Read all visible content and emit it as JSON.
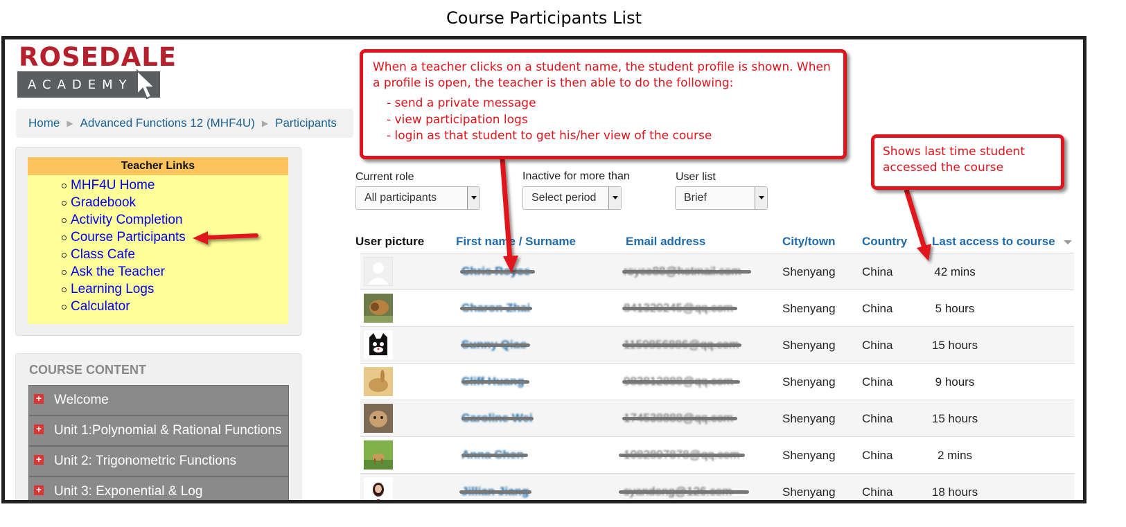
{
  "document_title": "Course Participants List",
  "logo": {
    "top": "ROSEDALE",
    "bottom": "ACADEMY"
  },
  "breadcrumb": [
    "Home",
    "Advanced Functions 12 (MHF4U)",
    "Participants"
  ],
  "teacher_links": {
    "title": "Teacher Links",
    "items": [
      "MHF4U Home",
      "Gradebook",
      "Activity Completion",
      "Course Participants",
      "Class Cafe",
      "Ask the Teacher",
      "Learning Logs",
      "Calculator"
    ]
  },
  "course_content": {
    "title": "COURSE CONTENT",
    "items": [
      "Welcome",
      "Unit 1:Polynomial & Rational Functions",
      "Unit 2: Trigonometric Functions",
      "Unit 3: Exponential & Log"
    ]
  },
  "filters": {
    "role": {
      "label": "Current role",
      "value": "All participants"
    },
    "inactive": {
      "label": "Inactive for more than",
      "value": "Select period"
    },
    "user_list": {
      "label": "User list",
      "value": "Brief"
    }
  },
  "table": {
    "headers": {
      "picture": "User picture",
      "name": "First name",
      "name_sep": " / ",
      "surname": "Surname",
      "email": "Email address",
      "city": "City/town",
      "country": "Country",
      "access": "Last access to course"
    },
    "rows": [
      {
        "name": "Chris Royce",
        "email": "royce88@hotmail.com",
        "city": "Shenyang",
        "country": "China",
        "access": "42 mins"
      },
      {
        "name": "Charon Zhai",
        "email": "841320245@qq.com",
        "city": "Shenyang",
        "country": "China",
        "access": "5 hours"
      },
      {
        "name": "Sunny Qiao",
        "email": "1150856886@qq.com",
        "city": "Shenyang",
        "country": "China",
        "access": "15 hours"
      },
      {
        "name": "Cliff Huang",
        "email": "983812888@qq.com",
        "city": "Shenyang",
        "country": "China",
        "access": "9 hours"
      },
      {
        "name": "Caroline Wei",
        "email": "174538888@qq.com",
        "city": "Shenyang",
        "country": "China",
        "access": "15 hours"
      },
      {
        "name": "Anna Chen",
        "email": "1082897878@qq.com",
        "city": "Shenyang",
        "country": "China",
        "access": "2 mins"
      },
      {
        "name": "Jillian Jiang",
        "email": "syandong@126.com",
        "city": "Shenyang",
        "country": "China",
        "access": "18 hours"
      }
    ]
  },
  "callouts": {
    "profile": {
      "text": "When a teacher clicks on a student name, the student profile is shown. When a profile is open, the teacher is then able to do the following:",
      "bullets": [
        "- send a private message",
        "- view participation logs",
        "- login as that student to get his/her view of the course"
      ]
    },
    "last_access": {
      "text": "Shows last time student accessed the course"
    }
  },
  "colors": {
    "callout": "#e0141a",
    "brand": "#b5202d",
    "link": "#1f6aa8",
    "teacher_links_bg": "#ffff99",
    "teacher_links_head": "#fcc45b"
  }
}
